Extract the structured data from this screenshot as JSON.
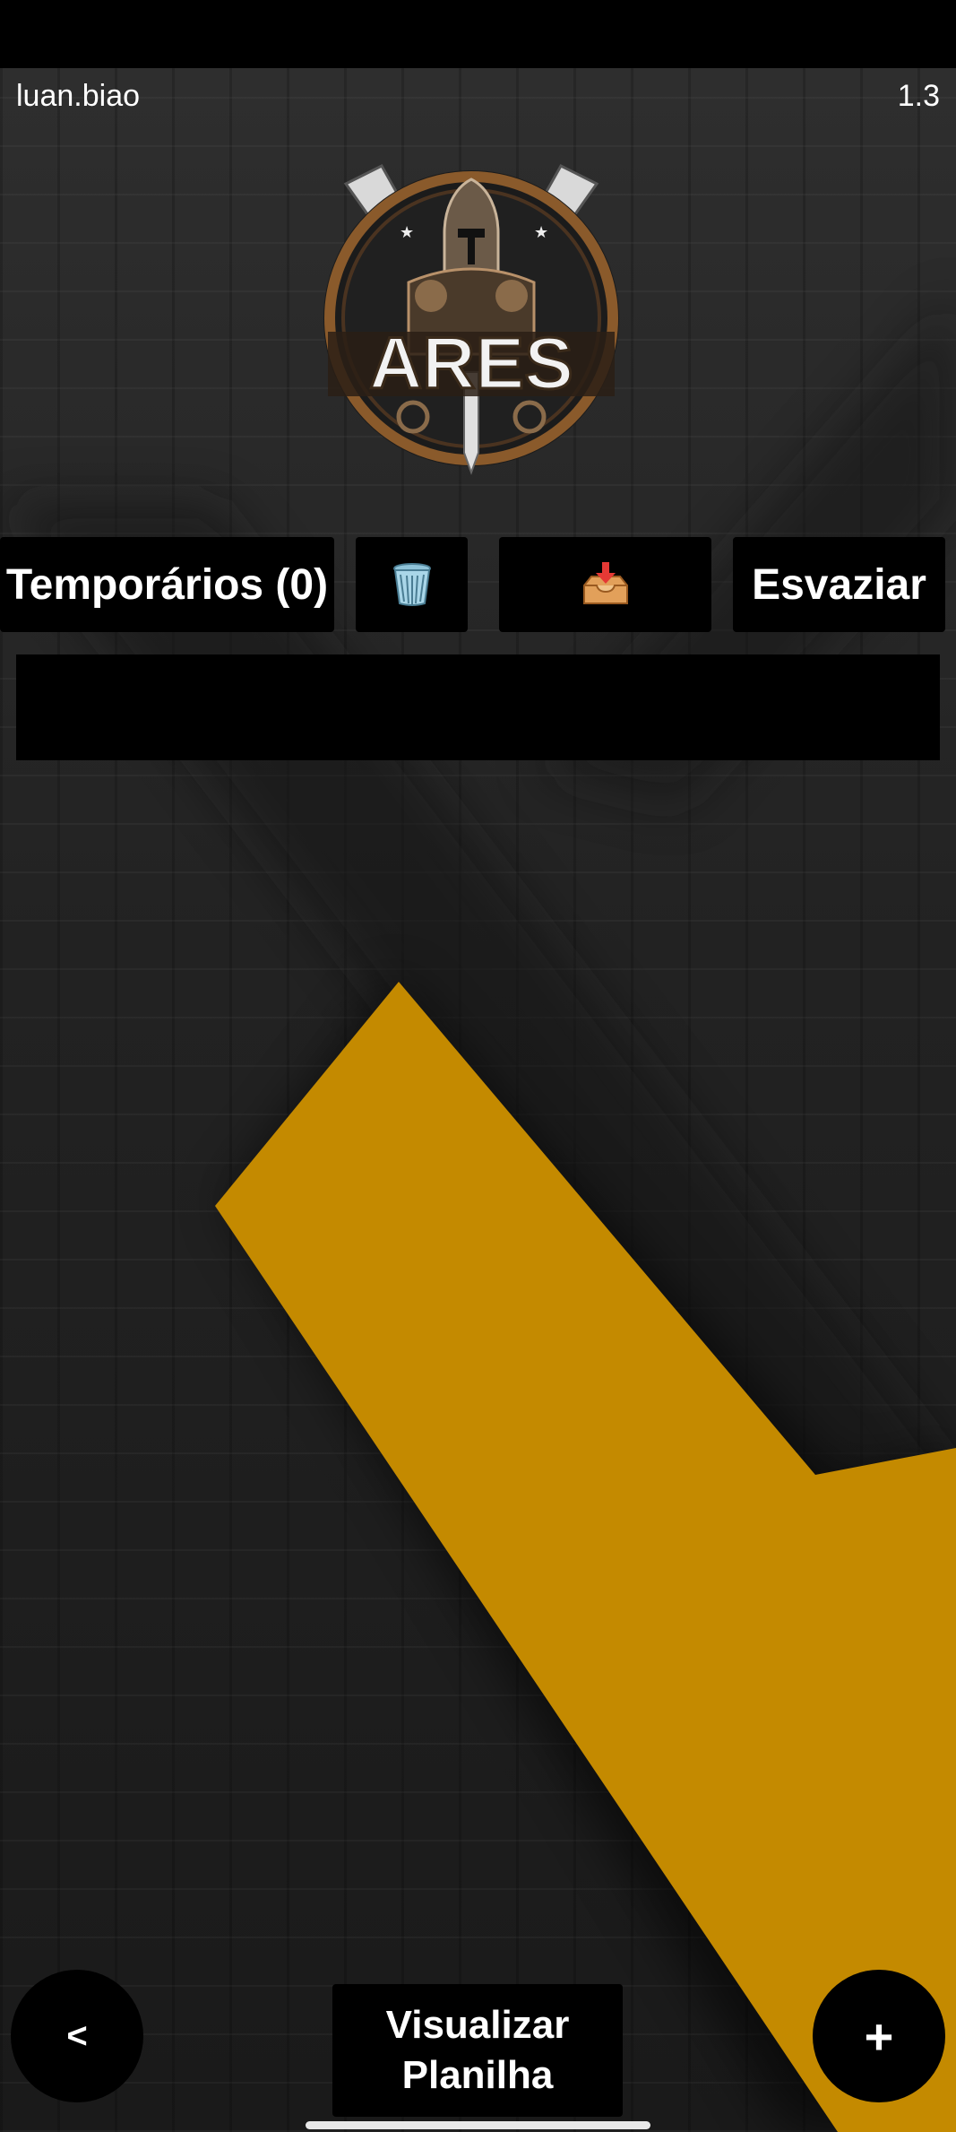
{
  "header": {
    "username": "luan.biao",
    "version": "1.3"
  },
  "logo": {
    "text": "ARES"
  },
  "toolbar": {
    "temporarios_label": "Temporários (0)",
    "trash_icon": "wastebasket-icon",
    "inbox_icon": "inbox-tray-icon",
    "esvaziar_label": "Esvaziar"
  },
  "footer": {
    "back_label": "<",
    "view_line1": "Visualizar",
    "view_line2": "Planilha",
    "add_label": "+"
  },
  "colors": {
    "accent_yellow": "#c48a00",
    "button_bg": "#000000"
  }
}
